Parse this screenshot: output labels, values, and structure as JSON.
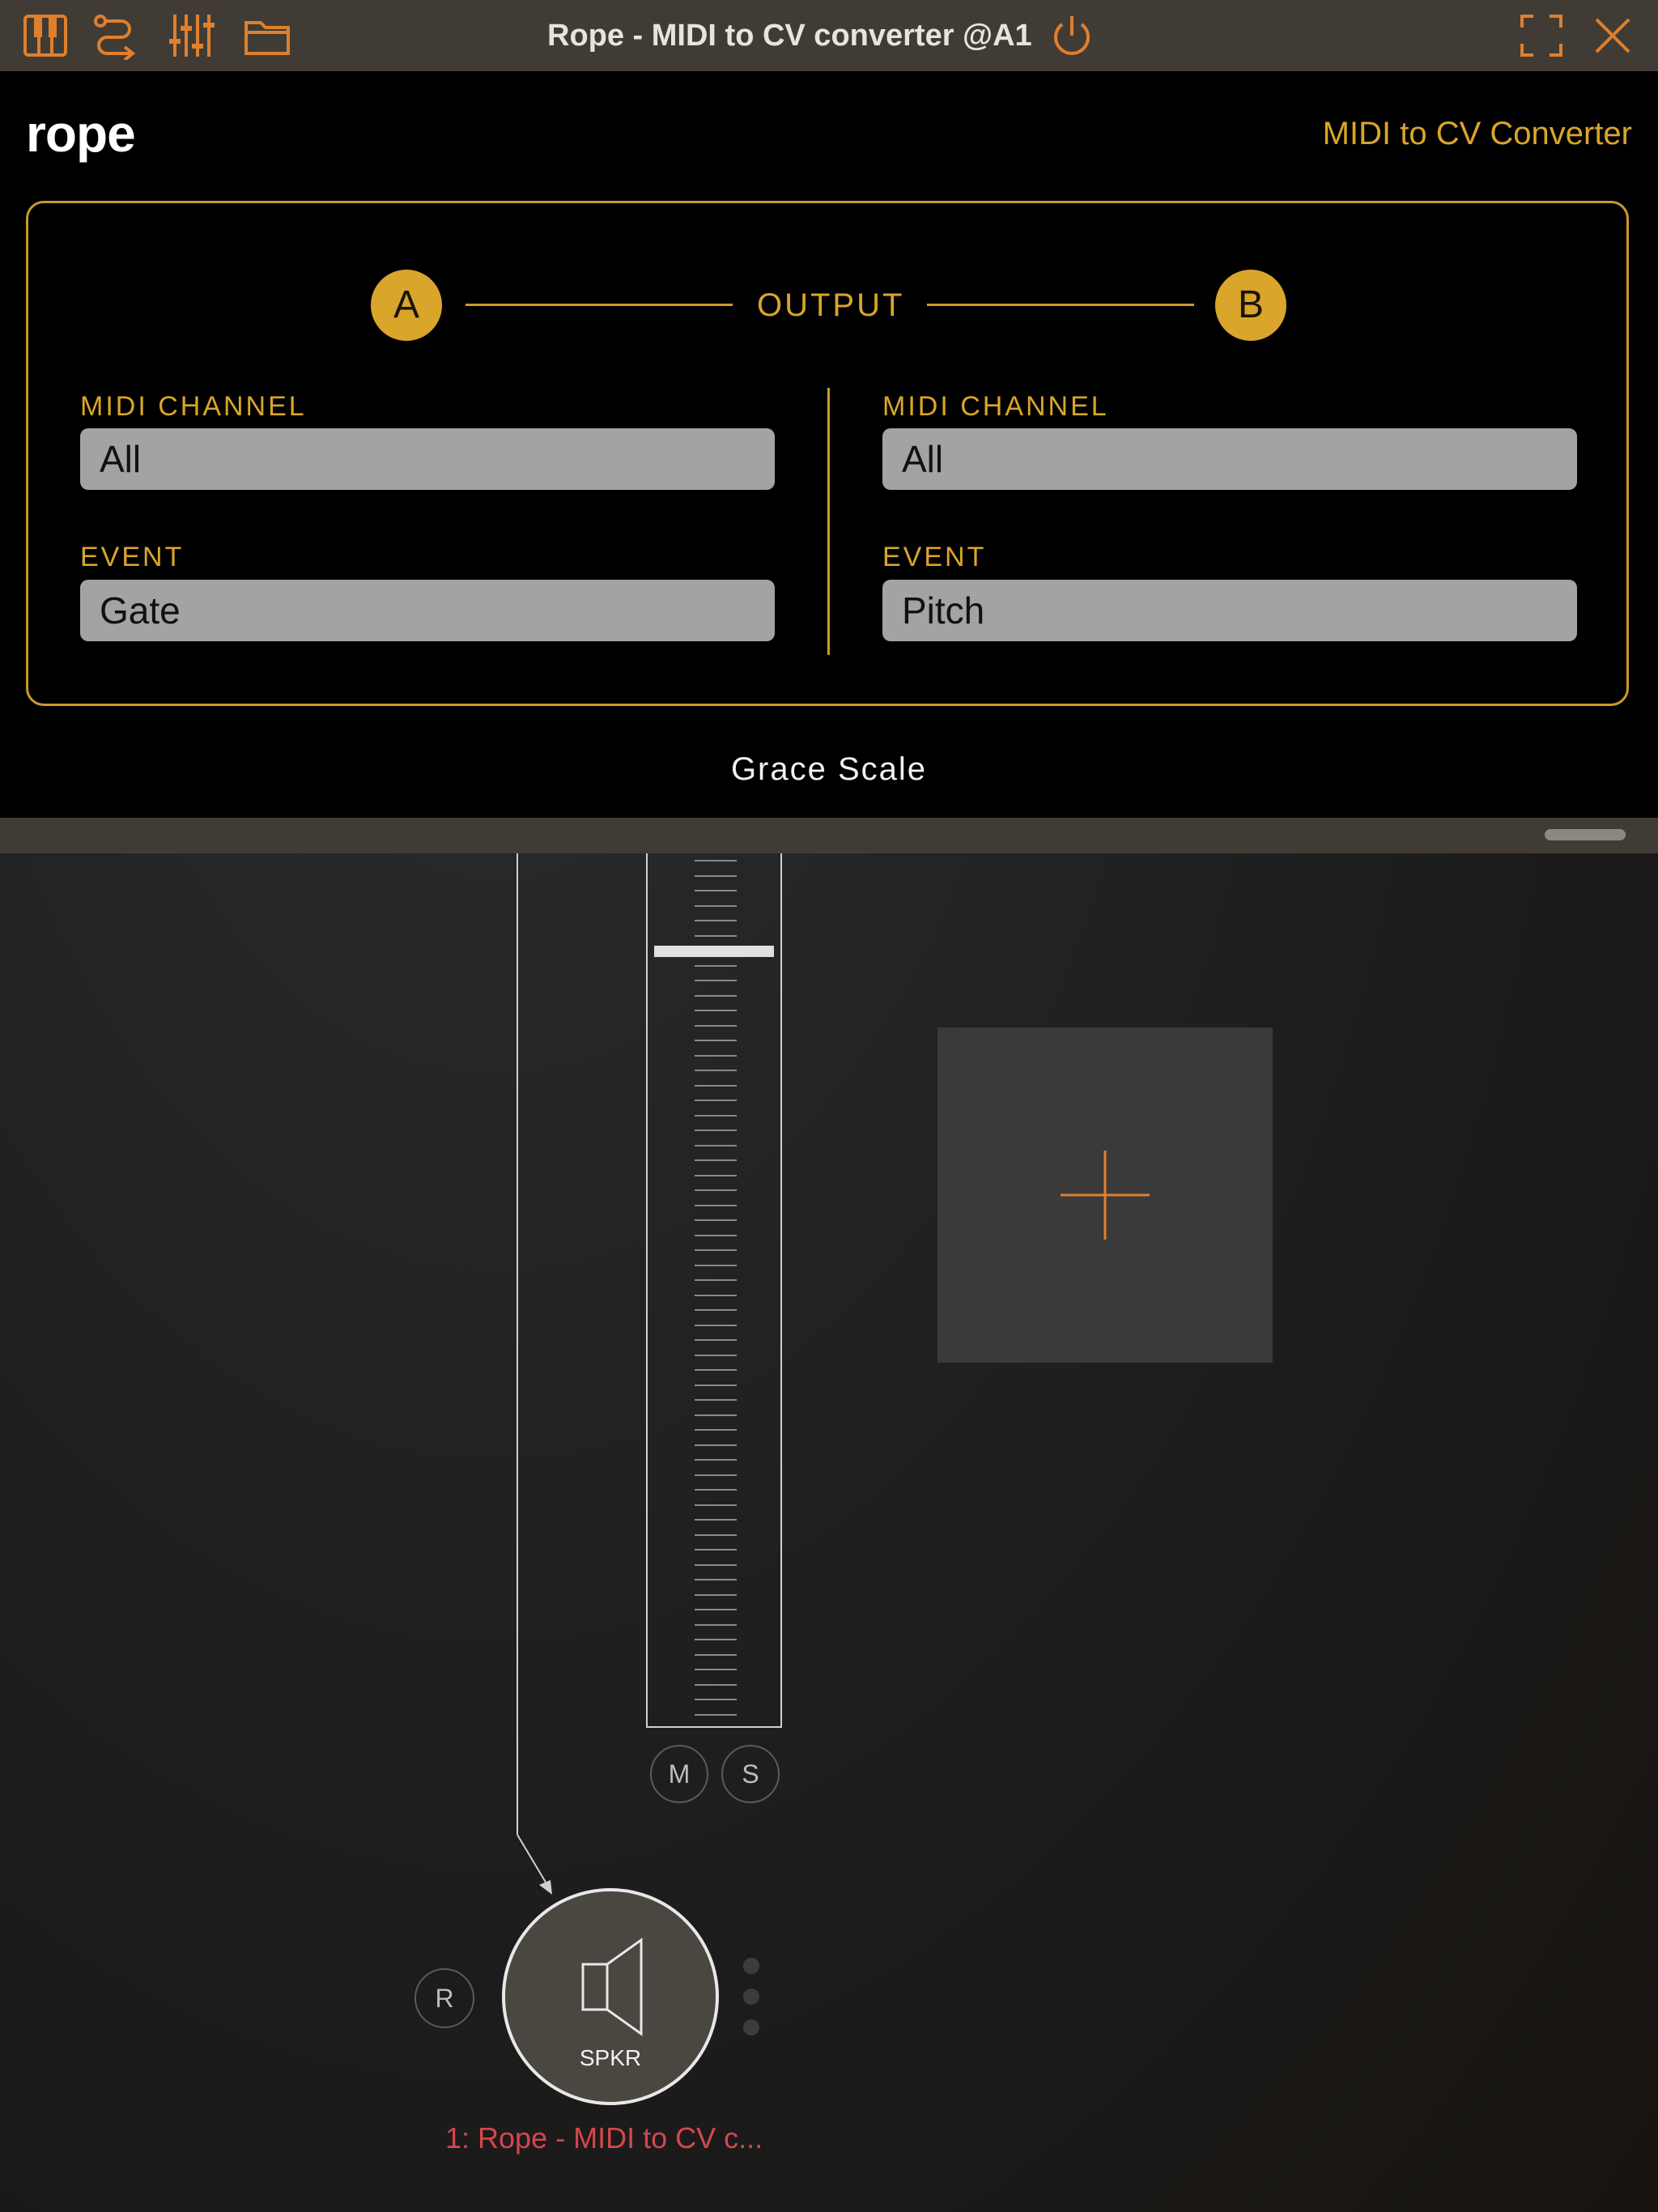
{
  "window": {
    "title": "Rope - MIDI to CV converter @A1",
    "toolbar_icons": [
      "piano-keys-icon",
      "routing-icon",
      "mixer-sliders-icon",
      "folder-icon"
    ],
    "right_icons": [
      "fullscreen-icon",
      "close-icon"
    ],
    "power_icon": "power-icon",
    "accent": "#e07f2c"
  },
  "plugin": {
    "logo": "rope",
    "subtitle": "MIDI to CV Converter",
    "accent": "#d9a52a",
    "output_label": "OUTPUT",
    "output_a": {
      "badge": "A",
      "midi_channel_label": "MIDI CHANNEL",
      "midi_channel_value": "All",
      "event_label": "EVENT",
      "event_value": "Gate"
    },
    "output_b": {
      "badge": "B",
      "midi_channel_label": "MIDI CHANNEL",
      "midi_channel_value": "All",
      "event_label": "EVENT",
      "event_value": "Pitch"
    },
    "footer": "Grace Scale"
  },
  "mixer": {
    "mute_label": "M",
    "solo_label": "S",
    "record_label": "R",
    "fader_level": 0.9,
    "output_node_label": "SPKR",
    "speaker_icon": "speaker-icon",
    "track_name": "1: Rope - MIDI to CV c...",
    "track_name_color": "#d3474f",
    "add_icon": "plus-icon"
  }
}
